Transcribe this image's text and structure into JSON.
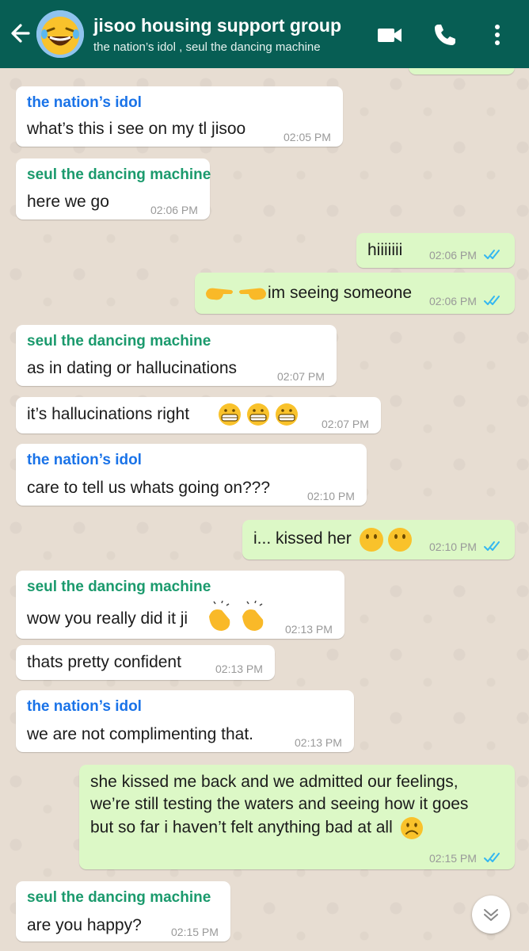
{
  "header": {
    "title": "jisoo housing support group",
    "subtitle": "the nation’s idol , seul the dancing machine",
    "icons": [
      "back-arrow-icon",
      "video-call-icon",
      "phone-icon",
      "more-vertical-icon"
    ]
  },
  "colors": {
    "header": "#075e54",
    "incoming_bubble": "#ffffff",
    "outgoing_bubble": "#dcf8c6",
    "sender_idol": "#1a73e8",
    "sender_seul": "#1b9a6d",
    "read_ticks": "#34b7f1"
  },
  "messages": [
    {
      "sender": "the nation’s idol",
      "text": "what’s this i see on my tl jisoo",
      "time": "02:05 PM"
    },
    {
      "sender": "seul the dancing machine",
      "text": "here we go",
      "time": "02:06 PM"
    },
    {
      "text": "hiiiiiii",
      "time": "02:06 PM"
    },
    {
      "text": "im seeing someone",
      "time": "02:06 PM"
    },
    {
      "sender": "seul the dancing machine",
      "text": "as in dating or hallucinations",
      "time": "02:07 PM"
    },
    {
      "text": "it’s hallucinations right",
      "time": "02:07 PM"
    },
    {
      "sender": "the nation’s idol",
      "text": "care to tell us whats going on???",
      "time": "02:10 PM"
    },
    {
      "text": "i... kissed her",
      "time": "02:10 PM"
    },
    {
      "sender": "seul the dancing machine",
      "text": "wow you really did it ji",
      "time": "02:13 PM"
    },
    {
      "text": "thats pretty confident",
      "time": "02:13 PM"
    },
    {
      "sender": "the nation’s idol",
      "text": "we are not complimenting that.",
      "time": "02:13 PM"
    },
    {
      "text": "she kissed me back and we admitted our feelings, we’re still testing the waters and seeing how it goes but so far i haven’t felt anything bad at all",
      "time": "02:15 PM"
    },
    {
      "sender": "seul the dancing machine",
      "text": "are you happy?",
      "time": "02:15 PM"
    }
  ]
}
